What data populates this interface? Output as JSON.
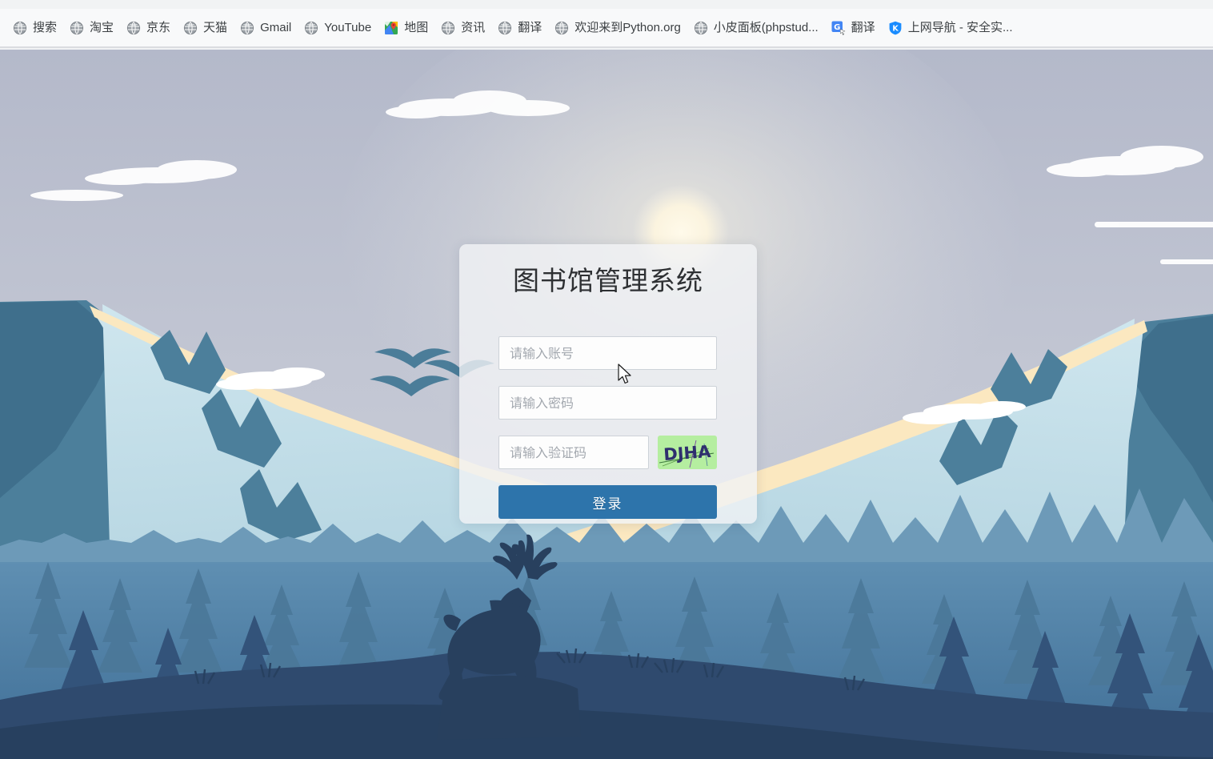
{
  "browser": {
    "omnibox_ghost_text": "",
    "bookmarks": [
      {
        "label": "搜索",
        "icon": "globe-icon"
      },
      {
        "label": "淘宝",
        "icon": "globe-icon"
      },
      {
        "label": "京东",
        "icon": "globe-icon"
      },
      {
        "label": "天猫",
        "icon": "globe-icon"
      },
      {
        "label": "Gmail",
        "icon": "globe-icon"
      },
      {
        "label": "YouTube",
        "icon": "globe-icon"
      },
      {
        "label": "地图",
        "icon": "google-maps-icon"
      },
      {
        "label": "资讯",
        "icon": "globe-icon"
      },
      {
        "label": "翻译",
        "icon": "globe-icon"
      },
      {
        "label": "欢迎来到Python.org",
        "icon": "globe-icon"
      },
      {
        "label": "小皮面板(phpstud...",
        "icon": "globe-icon"
      },
      {
        "label": "翻译",
        "icon": "google-translate-icon"
      },
      {
        "label": "上网导航 - 安全实...",
        "icon": "kingsoft-shield-icon"
      }
    ]
  },
  "login": {
    "title": "图书馆管理系统",
    "account": {
      "value": "",
      "placeholder": "请输入账号"
    },
    "password": {
      "value": "",
      "placeholder": "请输入密码"
    },
    "captcha": {
      "value": "",
      "placeholder": "请输入验证码",
      "image_text": "DJHA"
    },
    "submit_label": "登录"
  },
  "colors": {
    "primary_button": "#2d74ab",
    "card_background": "#f1f3f5",
    "captcha_background": "#b5eea0",
    "sky_top": "#b9bdcc",
    "sky_horizon": "#c8cbd6",
    "snow_light": "#bfdfe8",
    "mountain_dark": "#4c7f9b",
    "forest_far": "#5b87aa",
    "forest_near": "#2e4f72",
    "ground": "#2b4568",
    "sun": "#fdf6e0"
  }
}
